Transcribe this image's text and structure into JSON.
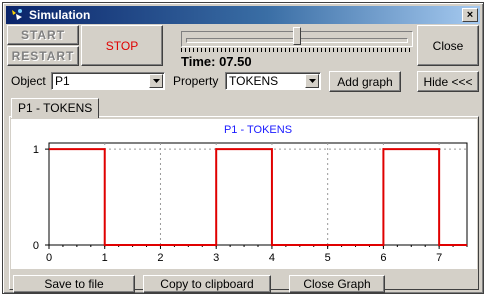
{
  "window": {
    "title": "Simulation",
    "close_glyph": "×"
  },
  "toolbar": {
    "start_label": "START",
    "restart_label": "RESTART",
    "stop_label": "STOP",
    "close_label": "Close",
    "time_prefix": "Time:",
    "time_value": "07.50",
    "slider_position": 0.5
  },
  "selectors": {
    "object_label": "Object",
    "object_value": "P1",
    "property_label": "Property",
    "property_value": "TOKENS",
    "add_graph_label": "Add graph",
    "hide_label": "Hide <<<"
  },
  "tabs": [
    {
      "label": "P1 - TOKENS"
    }
  ],
  "chart_data": {
    "type": "line",
    "title": "P1 - TOKENS",
    "step": true,
    "x": [
      0,
      1,
      1,
      3,
      3,
      4,
      4,
      6,
      6,
      7,
      7,
      7.5
    ],
    "y": [
      1,
      1,
      0,
      0,
      1,
      1,
      0,
      0,
      1,
      1,
      0,
      0
    ],
    "xlim": [
      0,
      7.5
    ],
    "ylim": [
      0,
      1
    ],
    "x_ticks": [
      0,
      1,
      2,
      3,
      4,
      5,
      6,
      7
    ],
    "y_ticks": [
      0,
      1
    ],
    "grid": true,
    "line_color": "#e00000",
    "title_color": "#1a1aff"
  },
  "footer": {
    "save_label": "Save to file",
    "copy_label": "Copy to clipboard",
    "close_graph_label": "Close Graph"
  },
  "colors": {
    "titlebar": "#0a246a",
    "stop": "#e00000",
    "face": "#d4d0c8"
  }
}
